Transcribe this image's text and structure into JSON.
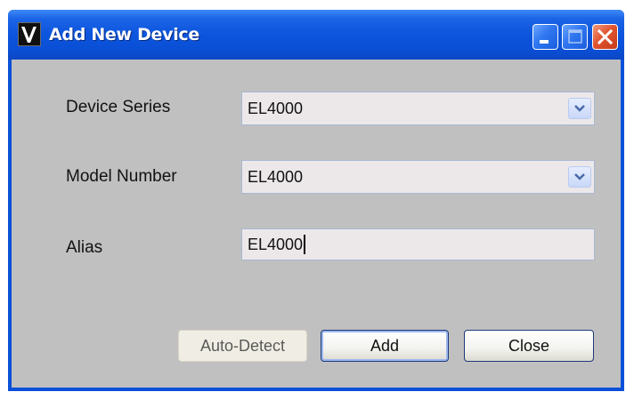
{
  "window": {
    "title": "Add New Device",
    "logo_letter": "V"
  },
  "titlebar_buttons": {
    "minimize_icon": "minimize-icon",
    "maximize_icon": "maximize-icon",
    "close_icon": "close-icon"
  },
  "form": {
    "device_series": {
      "label": "Device Series",
      "value": "EL4000"
    },
    "model_number": {
      "label": "Model Number",
      "value": "EL4000"
    },
    "alias": {
      "label": "Alias",
      "value": "EL4000"
    }
  },
  "buttons": {
    "auto_detect": "Auto-Detect",
    "add": "Add",
    "close": "Close"
  },
  "colors": {
    "titlebar": "#0a50d8",
    "client": "#c0c0c0",
    "field_bg": "#ece8ea",
    "close_button": "#e0552f"
  }
}
